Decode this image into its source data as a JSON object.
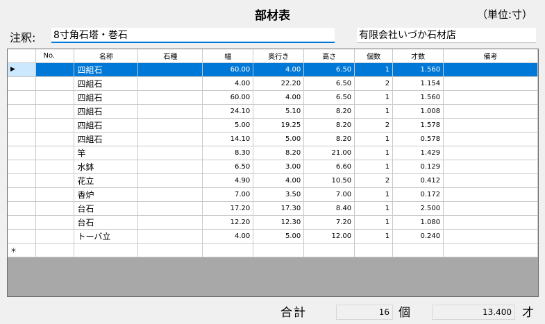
{
  "window": {
    "title": "部材表",
    "unit_note": "（単位:寸）"
  },
  "header": {
    "note_label": "注釈:",
    "note_value": "8寸角石塔・巻石",
    "company": "有限会社いづか石材店"
  },
  "grid": {
    "columns": [
      "No.",
      "名称",
      "石種",
      "幅",
      "奥行き",
      "高さ",
      "個数",
      "才数",
      "備考"
    ],
    "rows": [
      {
        "no": "",
        "name": "四組石",
        "stone": "",
        "width": "60.00",
        "depth": "4.00",
        "height": "6.50",
        "qty": "1",
        "volume": "1.560",
        "remarks": ""
      },
      {
        "no": "",
        "name": "四組石",
        "stone": "",
        "width": "4.00",
        "depth": "22.20",
        "height": "6.50",
        "qty": "2",
        "volume": "1.154",
        "remarks": ""
      },
      {
        "no": "",
        "name": "四組石",
        "stone": "",
        "width": "60.00",
        "depth": "4.00",
        "height": "6.50",
        "qty": "1",
        "volume": "1.560",
        "remarks": ""
      },
      {
        "no": "",
        "name": "四組石",
        "stone": "",
        "width": "24.10",
        "depth": "5.10",
        "height": "8.20",
        "qty": "1",
        "volume": "1.008",
        "remarks": ""
      },
      {
        "no": "",
        "name": "四組石",
        "stone": "",
        "width": "5.00",
        "depth": "19.25",
        "height": "8.20",
        "qty": "2",
        "volume": "1.578",
        "remarks": ""
      },
      {
        "no": "",
        "name": "四組石",
        "stone": "",
        "width": "14.10",
        "depth": "5.00",
        "height": "8.20",
        "qty": "1",
        "volume": "0.578",
        "remarks": ""
      },
      {
        "no": "",
        "name": "竿",
        "stone": "",
        "width": "8.30",
        "depth": "8.20",
        "height": "21.00",
        "qty": "1",
        "volume": "1.429",
        "remarks": ""
      },
      {
        "no": "",
        "name": "水鉢",
        "stone": "",
        "width": "6.50",
        "depth": "3.00",
        "height": "6.60",
        "qty": "1",
        "volume": "0.129",
        "remarks": ""
      },
      {
        "no": "",
        "name": "花立",
        "stone": "",
        "width": "4.90",
        "depth": "4.00",
        "height": "10.50",
        "qty": "2",
        "volume": "0.412",
        "remarks": ""
      },
      {
        "no": "",
        "name": "香炉",
        "stone": "",
        "width": "7.00",
        "depth": "3.50",
        "height": "7.00",
        "qty": "1",
        "volume": "0.172",
        "remarks": ""
      },
      {
        "no": "",
        "name": "台石",
        "stone": "",
        "width": "17.20",
        "depth": "17.30",
        "height": "8.40",
        "qty": "1",
        "volume": "2.500",
        "remarks": ""
      },
      {
        "no": "",
        "name": "台石",
        "stone": "",
        "width": "12.20",
        "depth": "12.30",
        "height": "7.20",
        "qty": "1",
        "volume": "1.080",
        "remarks": ""
      },
      {
        "no": "",
        "name": "トーバ立",
        "stone": "",
        "width": "4.00",
        "depth": "5.00",
        "height": "12.00",
        "qty": "1",
        "volume": "0.240",
        "remarks": ""
      }
    ],
    "current_row_marker": "▶",
    "new_row_marker": "＊"
  },
  "totals": {
    "label": "合計",
    "qty": "16",
    "qty_unit": "個",
    "volume": "13.400",
    "volume_unit": "才"
  },
  "colors": {
    "selection": "#0078d7",
    "row_header_selected": "#cce8ff",
    "grid_background": "#a8a8a8"
  }
}
